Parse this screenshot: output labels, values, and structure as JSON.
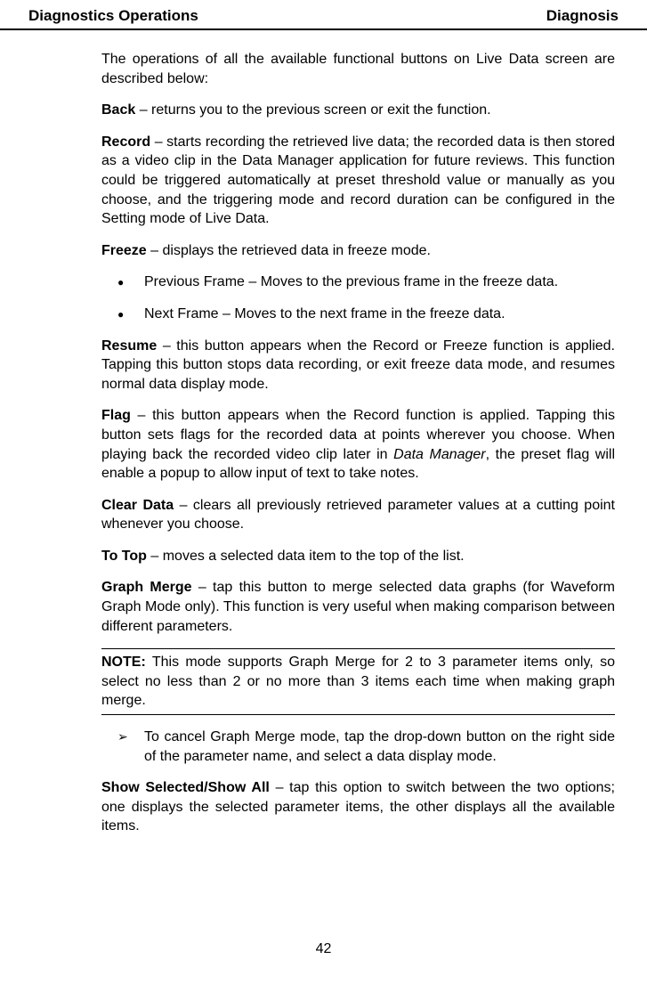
{
  "header": {
    "left": "Diagnostics Operations",
    "right": "Diagnosis"
  },
  "intro": "The operations of all the available functional buttons on Live Data screen are described below:",
  "items": {
    "back": {
      "label": "Back",
      "desc": " – returns you to the previous screen or exit the function."
    },
    "record": {
      "label": "Record",
      "desc": " – starts recording the retrieved live data; the recorded data is then stored as a video clip in the Data Manager application for future reviews. This function could be triggered automatically at preset threshold value or manually as you choose, and the triggering mode and record duration can be configured in the Setting mode of Live Data."
    },
    "freeze": {
      "label": "Freeze",
      "desc": " – displays the retrieved data in freeze mode."
    },
    "freeze_bullets": [
      "Previous Frame – Moves to the previous frame in the freeze data.",
      "Next Frame – Moves to the next frame in the freeze data."
    ],
    "resume": {
      "label": "Resume",
      "desc": " – this button appears when the Record or Freeze function is applied. Tapping this button stops data recording, or exit freeze data mode, and resumes normal data display mode."
    },
    "flag": {
      "label": "Flag",
      "desc_a": " – this button appears when the Record function is applied. Tapping this button sets flags for the recorded data at points wherever you choose. When playing back the recorded video clip later in ",
      "app": "Data Manager",
      "desc_b": ", the preset flag will enable a popup to allow input of text to take notes."
    },
    "clear": {
      "label": "Clear Data",
      "desc": " – clears all previously retrieved parameter values at a cutting point whenever you choose."
    },
    "totop": {
      "label": "To Top",
      "desc": " – moves a selected data item to the top of the list."
    },
    "graph": {
      "label": "Graph Merge",
      "desc": " – tap this button to merge selected data graphs (for Waveform Graph Mode only). This function is very useful when making comparison between different parameters."
    },
    "note": {
      "label": "NOTE:",
      "desc": " This mode supports Graph Merge for 2 to 3 parameter items only, so select no less than 2 or no more than 3 items each time when making graph merge."
    },
    "graph_cancel": "To cancel Graph Merge mode, tap the drop-down button on the right side of the parameter name, and select a data display mode.",
    "show": {
      "label": "Show Selected/Show All",
      "desc": " – tap this option to switch between the two options; one displays the selected parameter items, the other displays all the available items."
    }
  },
  "page_number": "42"
}
